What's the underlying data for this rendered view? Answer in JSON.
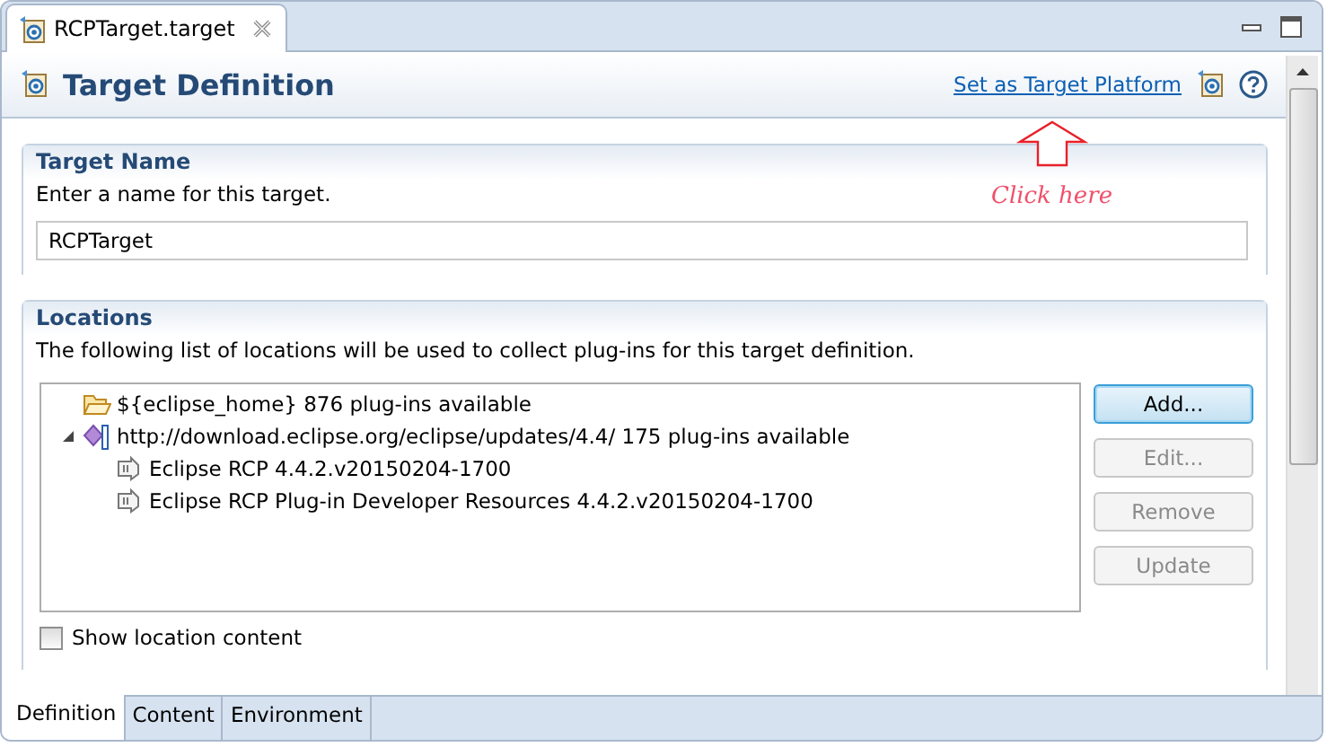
{
  "editor_tab": {
    "title": "RCPTarget.target"
  },
  "header": {
    "title": "Target Definition",
    "link": "Set as Target Platform"
  },
  "annotation": {
    "text": "Click here"
  },
  "target_name": {
    "title": "Target Name",
    "description": "Enter a name for this target.",
    "value": "RCPTarget"
  },
  "locations": {
    "title": "Locations",
    "description": "The following list of locations will be used to collect plug-ins for this target definition.",
    "tree": [
      {
        "kind": "folder",
        "label": "${eclipse_home} 876 plug-ins available"
      },
      {
        "kind": "repository",
        "label": "http://download.eclipse.org/eclipse/updates/4.4/ 175 plug-ins available",
        "expanded": true,
        "children": [
          {
            "kind": "feature",
            "label": "Eclipse RCP 4.4.2.v20150204-1700"
          },
          {
            "kind": "feature",
            "label": "Eclipse RCP Plug-in Developer Resources 4.4.2.v20150204-1700"
          }
        ]
      }
    ],
    "buttons": [
      {
        "label": "Add...",
        "disabled": false
      },
      {
        "label": "Edit...",
        "disabled": true
      },
      {
        "label": "Remove",
        "disabled": true
      },
      {
        "label": "Update",
        "disabled": true
      }
    ],
    "show_content": {
      "label": "Show location content",
      "checked": false
    }
  },
  "page_tabs": [
    {
      "label": "Definition",
      "selected": true
    },
    {
      "label": "Content",
      "selected": false
    },
    {
      "label": "Environment",
      "selected": false
    }
  ]
}
